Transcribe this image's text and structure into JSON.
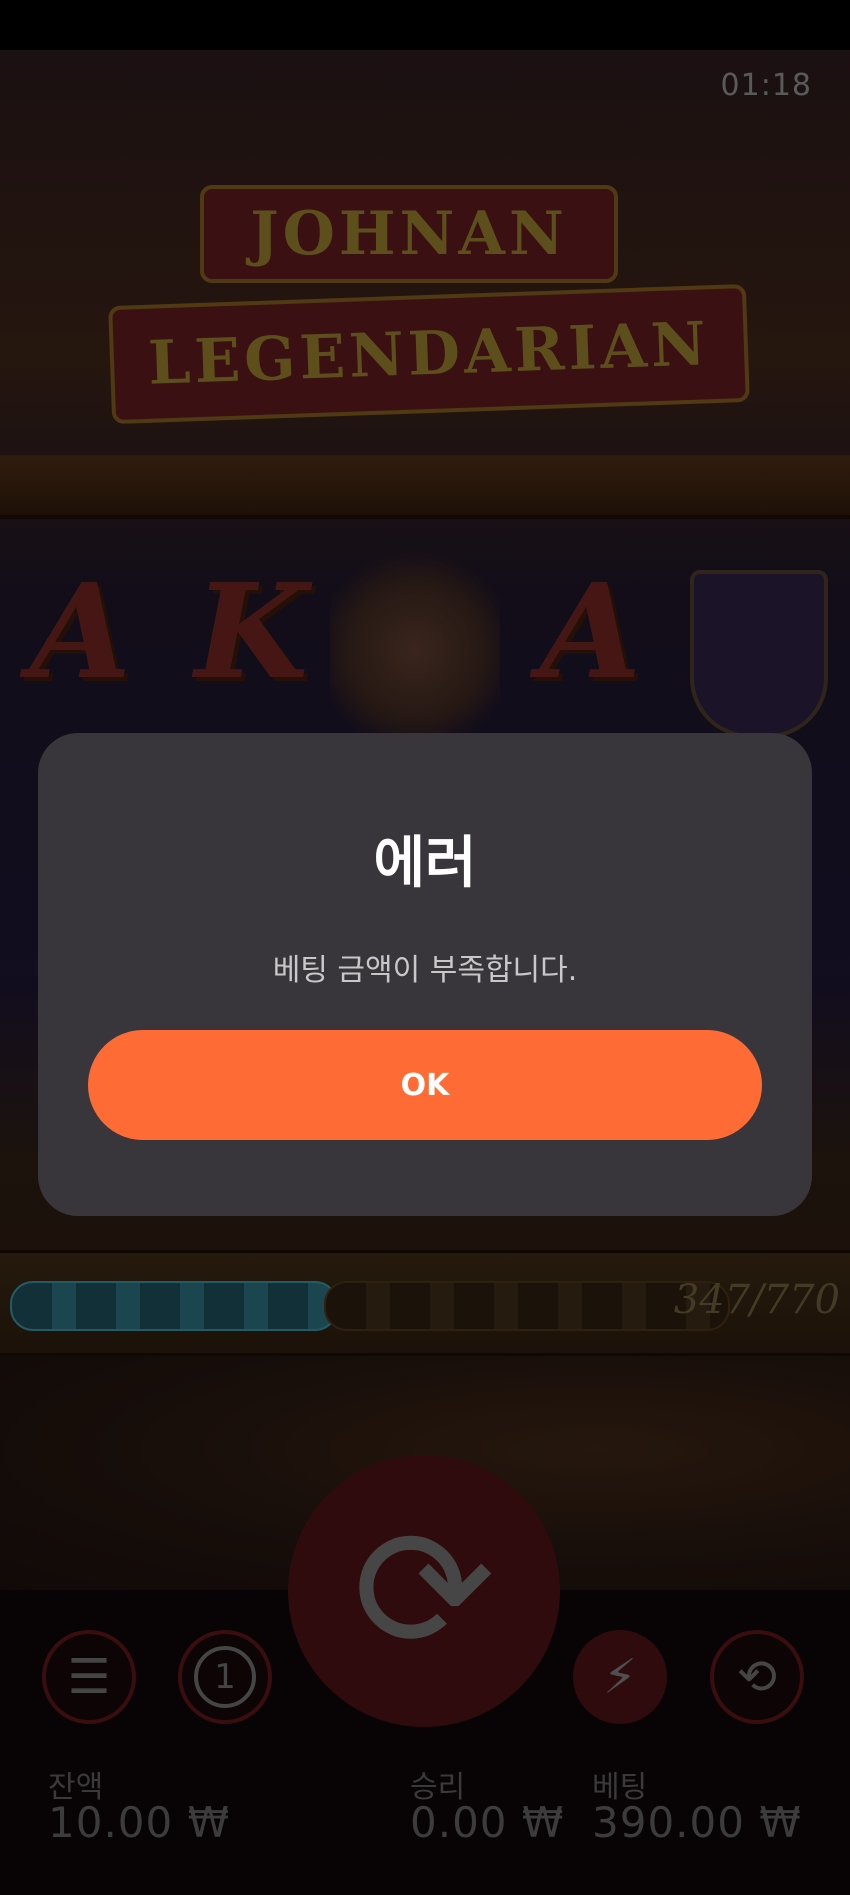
{
  "status": {
    "time": "01:18"
  },
  "game": {
    "title_line1": "JOHNAN",
    "title_line2": "LEGENDARIAN",
    "reel_symbols": [
      "A",
      "K",
      "A"
    ],
    "progress": {
      "text": "347/770",
      "fraction": 0.45
    },
    "colors": {
      "accent": "#ff6b35",
      "dialog_bg": "#38363b"
    }
  },
  "hud": {
    "menu_icon": "menu-icon",
    "coin_label": "1",
    "spin_icon": "refresh-icon",
    "turbo_icon": "lightning-icon",
    "autoplay_icon": "autoplay-icon",
    "balance": {
      "label": "잔액",
      "value": "10.00 ₩"
    },
    "win": {
      "label": "승리",
      "value": "0.00 ₩"
    },
    "bet": {
      "label": "베팅",
      "value": "390.00 ₩"
    }
  },
  "dialog": {
    "title": "에러",
    "message": "베팅 금액이 부족합니다.",
    "ok_label": "OK"
  }
}
